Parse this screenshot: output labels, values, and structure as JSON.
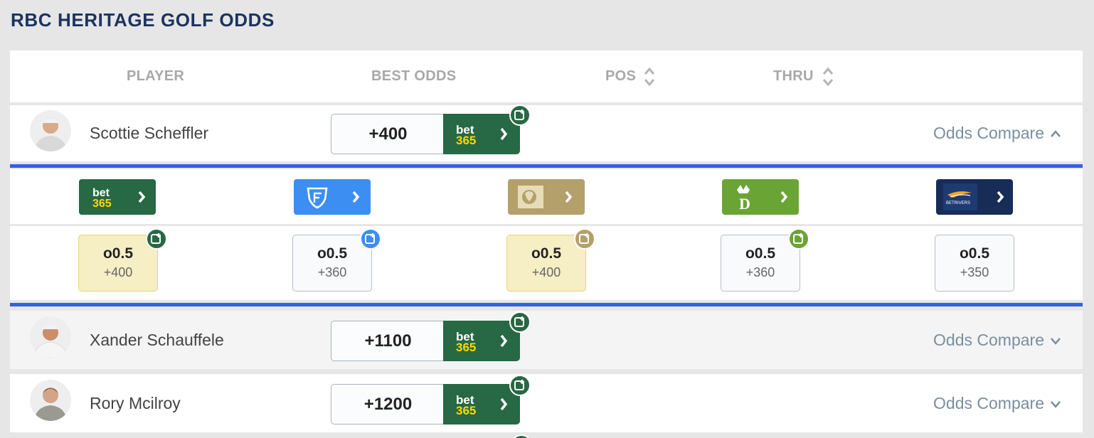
{
  "title": "RBC HERITAGE GOLF ODDS",
  "headers": {
    "player": "PLAYER",
    "best_odds": "BEST ODDS",
    "pos": "POS",
    "thru": "THRU"
  },
  "compare_label": "Odds Compare",
  "players": [
    {
      "name": "Scottie Scheffler",
      "best_odds": "+400",
      "book": "bet365",
      "expanded": true
    },
    {
      "name": "Xander Schauffele",
      "best_odds": "+1100",
      "book": "bet365",
      "expanded": false
    },
    {
      "name": "Rory Mcilroy",
      "best_odds": "+1200",
      "book": "bet365",
      "expanded": false
    }
  ],
  "books": [
    {
      "name": "bet365",
      "color": "#266944"
    },
    {
      "name": "FanDuel",
      "color": "#3c8ef2"
    },
    {
      "name": "BetMGM",
      "color": "#b4a06a"
    },
    {
      "name": "DraftKings",
      "color": "#6aa435"
    },
    {
      "name": "BetRivers",
      "color": "#172c57",
      "logo_text": "BETRIVERS"
    }
  ],
  "book_logo_text": {
    "bet": "bet",
    "n365": "365"
  },
  "lines": [
    {
      "line": "o0.5",
      "odds": "+400",
      "best": true
    },
    {
      "line": "o0.5",
      "odds": "+360",
      "best": false
    },
    {
      "line": "o0.5",
      "odds": "+400",
      "best": true
    },
    {
      "line": "o0.5",
      "odds": "+360",
      "best": false
    },
    {
      "line": "o0.5",
      "odds": "+350",
      "best": false
    }
  ]
}
